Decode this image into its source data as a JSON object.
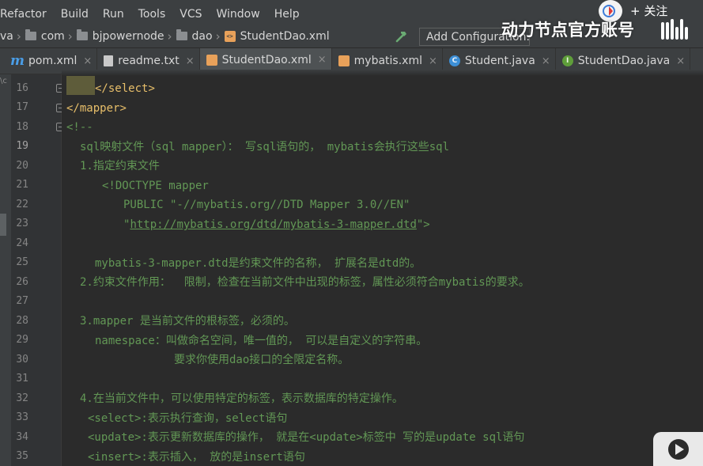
{
  "menu": {
    "items": [
      "Refactor",
      "Build",
      "Run",
      "Tools",
      "VCS",
      "Window",
      "Help"
    ]
  },
  "breadcrumb": {
    "items": [
      "va",
      "com",
      "bjpowernode",
      "dao",
      "StudentDao.xml"
    ]
  },
  "toolbar": {
    "add_configuration": "Add Configuration..."
  },
  "watermark": {
    "follow": "+ 关注",
    "title": "动力节点官方账号"
  },
  "tabs": [
    {
      "label": "pom.xml",
      "icon": "maven-m-icon"
    },
    {
      "label": "readme.txt",
      "icon": "text-file-icon"
    },
    {
      "label": "StudentDao.xml",
      "icon": "xml-file-icon",
      "active": true
    },
    {
      "label": "mybatis.xml",
      "icon": "xml-file-icon"
    },
    {
      "label": "Student.java",
      "icon": "java-class-icon"
    },
    {
      "label": "StudentDao.java",
      "icon": "java-interface-icon"
    }
  ],
  "left_strip_label": "\\c",
  "editor": {
    "current_line": 19,
    "lines": [
      {
        "n": "16",
        "open": "</",
        "tag": "select",
        "close": ">",
        "text": ""
      },
      {
        "n": "17",
        "open": "</",
        "tag": "mapper",
        "close": ">",
        "text": ""
      },
      {
        "n": "18",
        "text": "<!--"
      },
      {
        "n": "19",
        "text": "sql映射文件（sql mapper）： 写sql语句的， mybatis会执行这些sql"
      },
      {
        "n": "20",
        "text": "1.指定约束文件"
      },
      {
        "n": "21",
        "text": "<!DOCTYPE mapper"
      },
      {
        "n": "22",
        "text": "PUBLIC \"-//mybatis.org//DTD Mapper 3.0//EN\""
      },
      {
        "n": "23",
        "pre": "\"",
        "link": "http://mybatis.org/dtd/mybatis-3-mapper.dtd",
        "post": "\">"
      },
      {
        "n": "24",
        "text": ""
      },
      {
        "n": "25",
        "text": "mybatis-3-mapper.dtd是约束文件的名称， 扩展名是dtd的。"
      },
      {
        "n": "26",
        "text": "2.约束文件作用：  限制，检查在当前文件中出现的标签，属性必须符合mybatis的要求。"
      },
      {
        "n": "27",
        "text": ""
      },
      {
        "n": "28",
        "text": "3.mapper 是当前文件的根标签，必须的。"
      },
      {
        "n": "29",
        "text": "namespace：叫做命名空间，唯一值的， 可以是自定义的字符串。"
      },
      {
        "n": "30",
        "text": "要求你使用dao接口的全限定名称。"
      },
      {
        "n": "31",
        "text": ""
      },
      {
        "n": "32",
        "text": "4.在当前文件中，可以使用特定的标签，表示数据库的特定操作。"
      },
      {
        "n": "33",
        "text": "<select>:表示执行查询，select语句"
      },
      {
        "n": "34",
        "text": "<update>:表示更新数据库的操作， 就是在<update>标签中 写的是update sql语句"
      },
      {
        "n": "35",
        "text": "<insert>:表示插入， 放的是insert语句"
      }
    ]
  }
}
